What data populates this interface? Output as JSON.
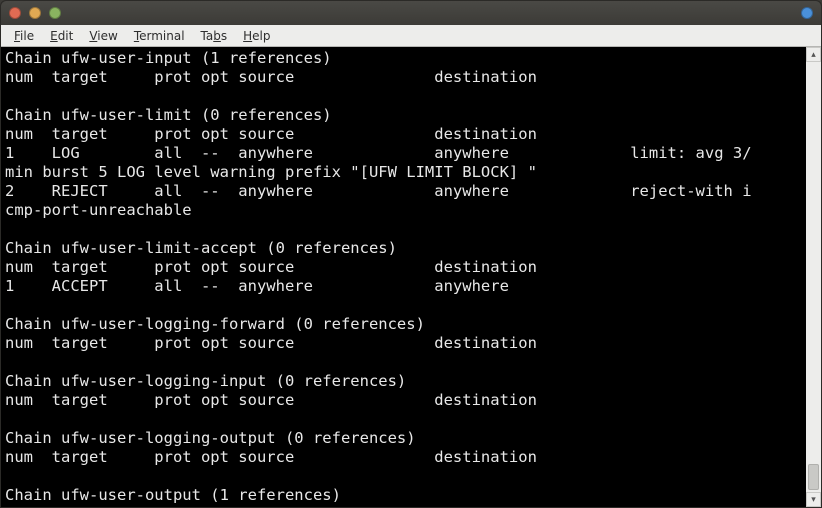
{
  "menubar": {
    "file": "File",
    "edit": "Edit",
    "view": "View",
    "terminal": "Terminal",
    "tabs": "Tabs",
    "help": "Help"
  },
  "terminal": {
    "content": "Chain ufw-user-input (1 references)\nnum  target     prot opt source               destination\n\nChain ufw-user-limit (0 references)\nnum  target     prot opt source               destination\n1    LOG        all  --  anywhere             anywhere             limit: avg 3/\nmin burst 5 LOG level warning prefix \"[UFW LIMIT BLOCK] \"\n2    REJECT     all  --  anywhere             anywhere             reject-with i\ncmp-port-unreachable\n\nChain ufw-user-limit-accept (0 references)\nnum  target     prot opt source               destination\n1    ACCEPT     all  --  anywhere             anywhere\n\nChain ufw-user-logging-forward (0 references)\nnum  target     prot opt source               destination\n\nChain ufw-user-logging-input (0 references)\nnum  target     prot opt source               destination\n\nChain ufw-user-logging-output (0 references)\nnum  target     prot opt source               destination\n\nChain ufw-user-output (1 references)"
  }
}
